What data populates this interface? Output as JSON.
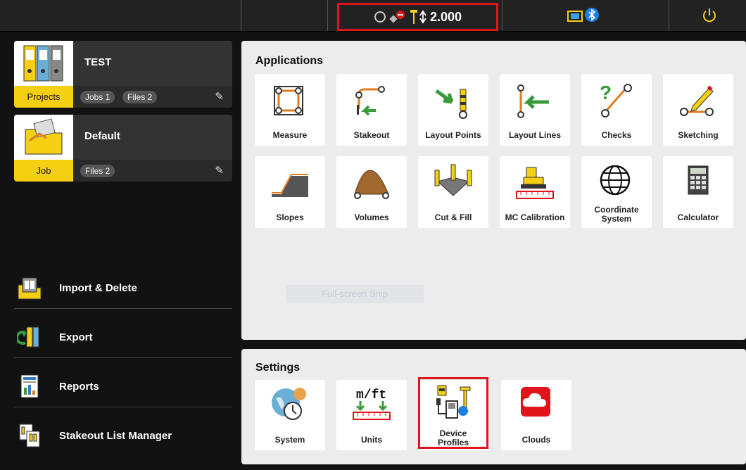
{
  "topbar": {
    "status_value": "2.000",
    "icons": [
      "target-circle-icon",
      "satellite-disabled-icon",
      "receiver-height-icon",
      "battery-icon",
      "bluetooth-icon",
      "power-icon"
    ]
  },
  "cards": [
    {
      "title": "TEST",
      "tag": "Projects",
      "pills": [
        "Jobs 1",
        "Files 2"
      ],
      "icon": "project-binders-icon"
    },
    {
      "title": "Default",
      "tag": "Job",
      "pills": [
        "Files 2"
      ],
      "icon": "job-folder-icon"
    }
  ],
  "left_menu": [
    {
      "label": "Import & Delete",
      "icon": "import-delete-icon"
    },
    {
      "label": "Export",
      "icon": "export-icon"
    },
    {
      "label": "Reports",
      "icon": "reports-icon"
    },
    {
      "label": "Stakeout List Manager",
      "icon": "stakeout-list-icon"
    }
  ],
  "applications": {
    "title": "Applications",
    "tiles": [
      "Measure",
      "Stakeout",
      "Layout Points",
      "Layout Lines",
      "Checks",
      "Sketching",
      "Slopes",
      "Volumes",
      "Cut & Fill",
      "MC Calibration",
      "Coordinate System",
      "Calculator"
    ]
  },
  "settings": {
    "title": "Settings",
    "tiles": [
      "System",
      "Units",
      "Device Profiles",
      "Clouds"
    ]
  },
  "overlay": {
    "snip_label": "Full-screen Snip"
  },
  "colors": {
    "accent": "#f5cf12",
    "highlight": "#e0141a",
    "panel": "#ececec",
    "background": "#121212"
  }
}
